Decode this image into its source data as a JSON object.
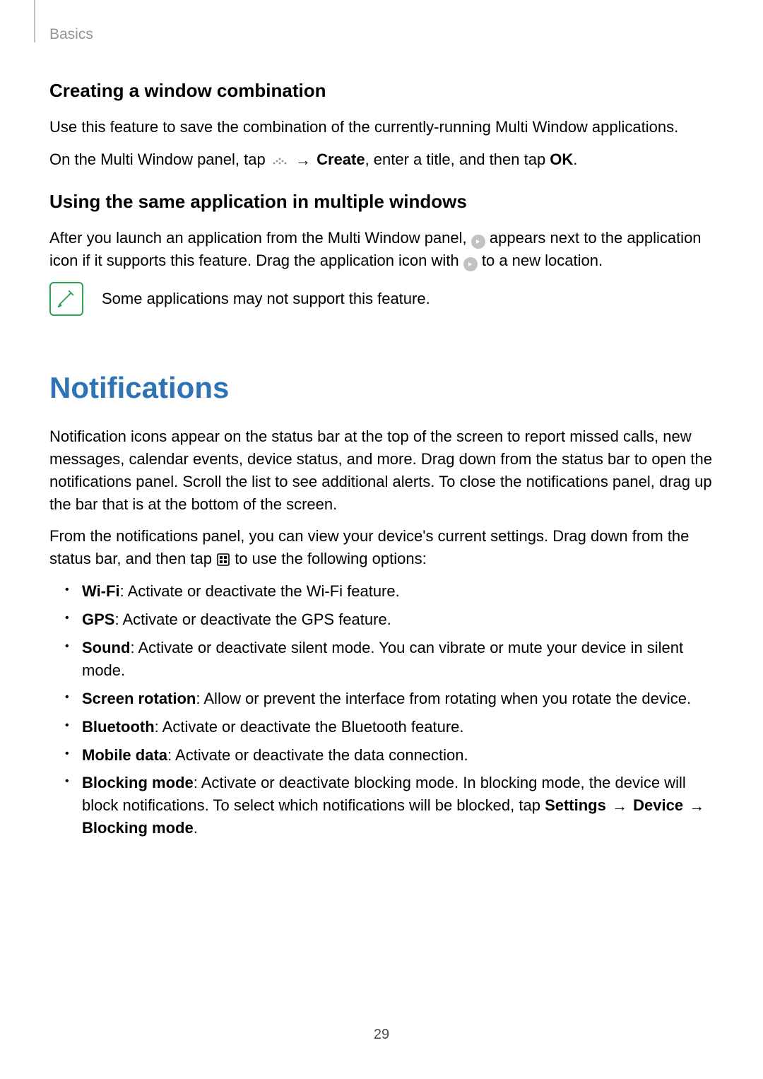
{
  "breadcrumb": "Basics",
  "page_number": "29",
  "section1": {
    "heading": "Creating a window combination",
    "p1": "Use this feature to save the combination of the currently-running Multi Window applications.",
    "p2_pre": "On the Multi Window panel, tap ",
    "p2_icon": "panel-handle-icon",
    "p2_arrow": "→",
    "p2_bold": "Create",
    "p2_mid": ", enter a title, and then tap ",
    "p2_bold2": "OK",
    "p2_end": "."
  },
  "section2": {
    "heading": "Using the same application in multiple windows",
    "p1_pre": "After you launch an application from the Multi Window panel, ",
    "p1_icon": "duplicate-badge-icon",
    "p1_mid": " appears next to the application icon if it supports this feature. Drag the application icon with ",
    "p1_icon2": "duplicate-badge-icon",
    "p1_end": " to a new location.",
    "note": "Some applications may not support this feature."
  },
  "section3": {
    "title": "Notifications",
    "p1": "Notification icons appear on the status bar at the top of the screen to report missed calls, new messages, calendar events, device status, and more. Drag down from the status bar to open the notifications panel. Scroll the list to see additional alerts. To close the notifications panel, drag up the bar that is at the bottom of the screen.",
    "p2_pre": "From the notifications panel, you can view your device's current settings. Drag down from the status bar, and then tap ",
    "p2_icon": "quick-settings-grid-icon",
    "p2_end": " to use the following options:",
    "options": [
      {
        "name": "Wi-Fi",
        "desc": ": Activate or deactivate the Wi-Fi feature."
      },
      {
        "name": "GPS",
        "desc": ": Activate or deactivate the GPS feature."
      },
      {
        "name": "Sound",
        "desc": ": Activate or deactivate silent mode. You can vibrate or mute your device in silent mode."
      },
      {
        "name": "Screen rotation",
        "desc": ": Allow or prevent the interface from rotating when you rotate the device."
      },
      {
        "name": "Bluetooth",
        "desc": ": Activate or deactivate the Bluetooth feature."
      },
      {
        "name": "Mobile data",
        "desc": ": Activate or deactivate the data connection."
      }
    ],
    "blocking": {
      "name": "Blocking mode",
      "desc_pre": ": Activate or deactivate blocking mode. In blocking mode, the device will block notifications. To select which notifications will be blocked, tap ",
      "path1": "Settings",
      "arrow1": "→",
      "path2": "Device",
      "arrow2": "→",
      "path3": "Blocking mode",
      "desc_end": "."
    }
  }
}
